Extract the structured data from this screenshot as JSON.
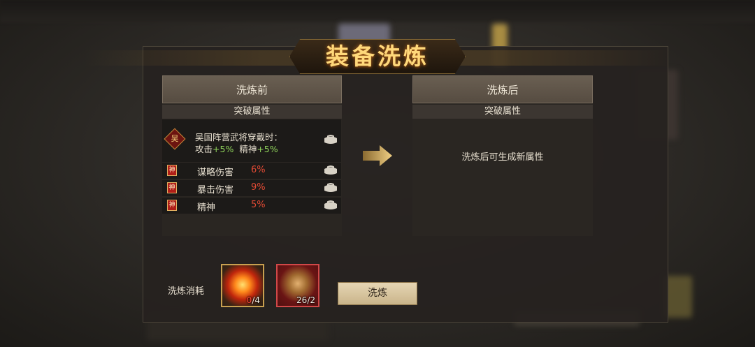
{
  "title": "装备洗炼",
  "before": {
    "header": "洗炼前",
    "subheader": "突破属性",
    "set_bonus": {
      "icon_char": "吴",
      "line1": "吴国阵营武将穿戴时：",
      "line2_atk_label": "攻击",
      "line2_atk_value": "+5%",
      "line2_spirit_label": "精神",
      "line2_spirit_value": "+5%"
    },
    "attributes": [
      {
        "badge": "神",
        "name": "谋略伤害",
        "value": "6%"
      },
      {
        "badge": "神",
        "name": "暴击伤害",
        "value": "9%"
      },
      {
        "badge": "神",
        "name": "精神",
        "value": "5%"
      }
    ]
  },
  "after": {
    "header": "洗炼后",
    "subheader": "突破属性",
    "placeholder": "洗炼后可生成新属性"
  },
  "cost": {
    "label": "洗炼消耗",
    "items": [
      {
        "icon": "fire-orb-icon",
        "have": "0",
        "need": "/4"
      },
      {
        "icon": "gold-ingot-icon",
        "count": "26/2"
      }
    ]
  },
  "refine_button": "洗炼",
  "colors": {
    "title": "#ffd87a",
    "value_red": "#e04a34",
    "value_green": "#8fd25a",
    "button": "#d8c49c"
  }
}
